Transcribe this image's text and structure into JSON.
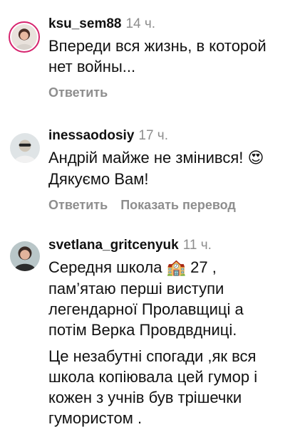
{
  "comments": [
    {
      "username": "ksu_sem88",
      "time": "14 ч.",
      "text": "Впереди вся жизнь, в которой\nнет войны...",
      "reply_label": "Ответить"
    },
    {
      "username": "inessaodosiy",
      "time": "17 ч.",
      "text_line1": "Андрій майже не змінився! ",
      "emoji": "😍",
      "text_line2": "Дякуємо Вам!",
      "reply_label": "Ответить",
      "translate_label": "Показать перевод"
    },
    {
      "username": "svetlana_gritcenyuk",
      "time": "11 ч.",
      "text_a1": "Середня  школа ",
      "emoji": "🏫",
      "text_a2": " 27 ,",
      "text_b": "пам’ятаю перші виступи\nлегендарної  Пролавщиці а\nпотім Верка Провдвдниці.",
      "text_c": " Це незабутні спогади ,як вся\nшкола копіювала цей гумор і\nкожен з учнів був  трішечки\nгумористом ."
    }
  ]
}
